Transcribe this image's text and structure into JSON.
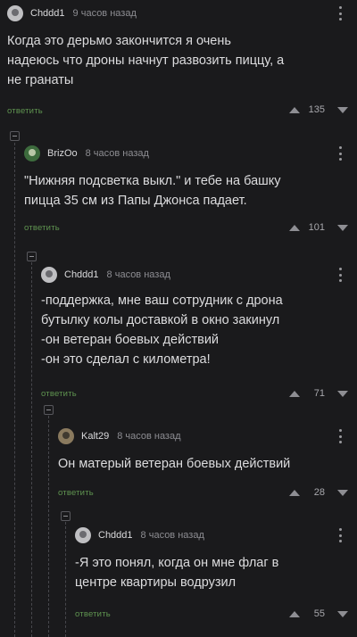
{
  "comments": [
    {
      "author": "Chddd1",
      "time": "9 часов назад",
      "text": "Когда это дерьмо закончится я очень\nнадеюсь что дроны начнут развозить пиццу, а\nне гранаты",
      "reply_label": "ответить",
      "score": "135"
    },
    {
      "author": "BrizOo",
      "time": "8 часов назад",
      "text": "\"Нижняя подсветка выкл.\" и тебе на башку\nпицца 35 см из Папы Джонса падает.",
      "reply_label": "ответить",
      "score": "101"
    },
    {
      "author": "Chddd1",
      "time": "8 часов назад",
      "text": "-поддержка, мне ваш сотрудник с дрона\nбутылку колы доставкой в окно закинул\n-он ветеран боевых действий\n-он это сделал с километра!",
      "reply_label": "ответить",
      "score": "71"
    },
    {
      "author": "Kalt29",
      "time": "8 часов назад",
      "text": "Он матерый ветеран боевых действий",
      "reply_label": "ответить",
      "score": "28"
    },
    {
      "author": "Chddd1",
      "time": "8 часов назад",
      "text": "-Я это понял, когда он мне флаг в\nцентре квартиры водрузил",
      "reply_label": "ответить",
      "score": "55"
    }
  ]
}
